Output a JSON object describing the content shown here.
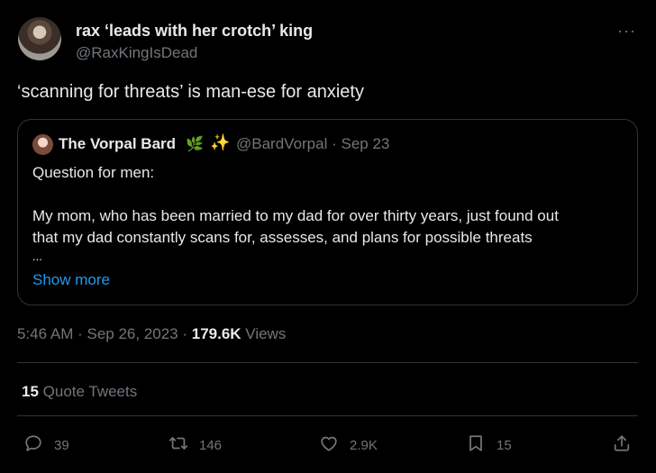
{
  "tweet": {
    "author_name": "rax ‘leads with her crotch’ king",
    "author_handle": "@RaxKingIsDead",
    "more_icon": "more-horizontal-icon",
    "text": "‘scanning for threats’ is man-ese for anxiety"
  },
  "quote": {
    "author_name": "The Vorpal Bard",
    "emoji_1": "🌿",
    "emoji_2": "✨",
    "meta": "@BardVorpal · Sep 23",
    "line1": "Question for men:",
    "line2": "My mom, who has been married to my dad for over thirty years, just found out",
    "line3": "that my dad constantly scans for, assesses, and plans for possible threats",
    "ellipsis": "...",
    "show_more": "Show more"
  },
  "meta": {
    "timestamp": "5:46 AM · Sep 26, 2023 · ",
    "views_count": "179.6K",
    "views_label": " Views"
  },
  "quote_tweets": {
    "count": "15",
    "label": " Quote Tweets"
  },
  "actions": {
    "reply": {
      "icon": "reply-icon",
      "count": "39"
    },
    "retweet": {
      "icon": "retweet-icon",
      "count": "146"
    },
    "like": {
      "icon": "heart-icon",
      "count": "2.9K"
    },
    "bookmark": {
      "icon": "bookmark-icon",
      "count": "15"
    },
    "share": {
      "icon": "share-icon"
    }
  },
  "colors": {
    "background": "#000000",
    "text": "#e7e9ea",
    "muted": "#71767b",
    "link": "#1d9bf0",
    "border": "#2f3336"
  }
}
